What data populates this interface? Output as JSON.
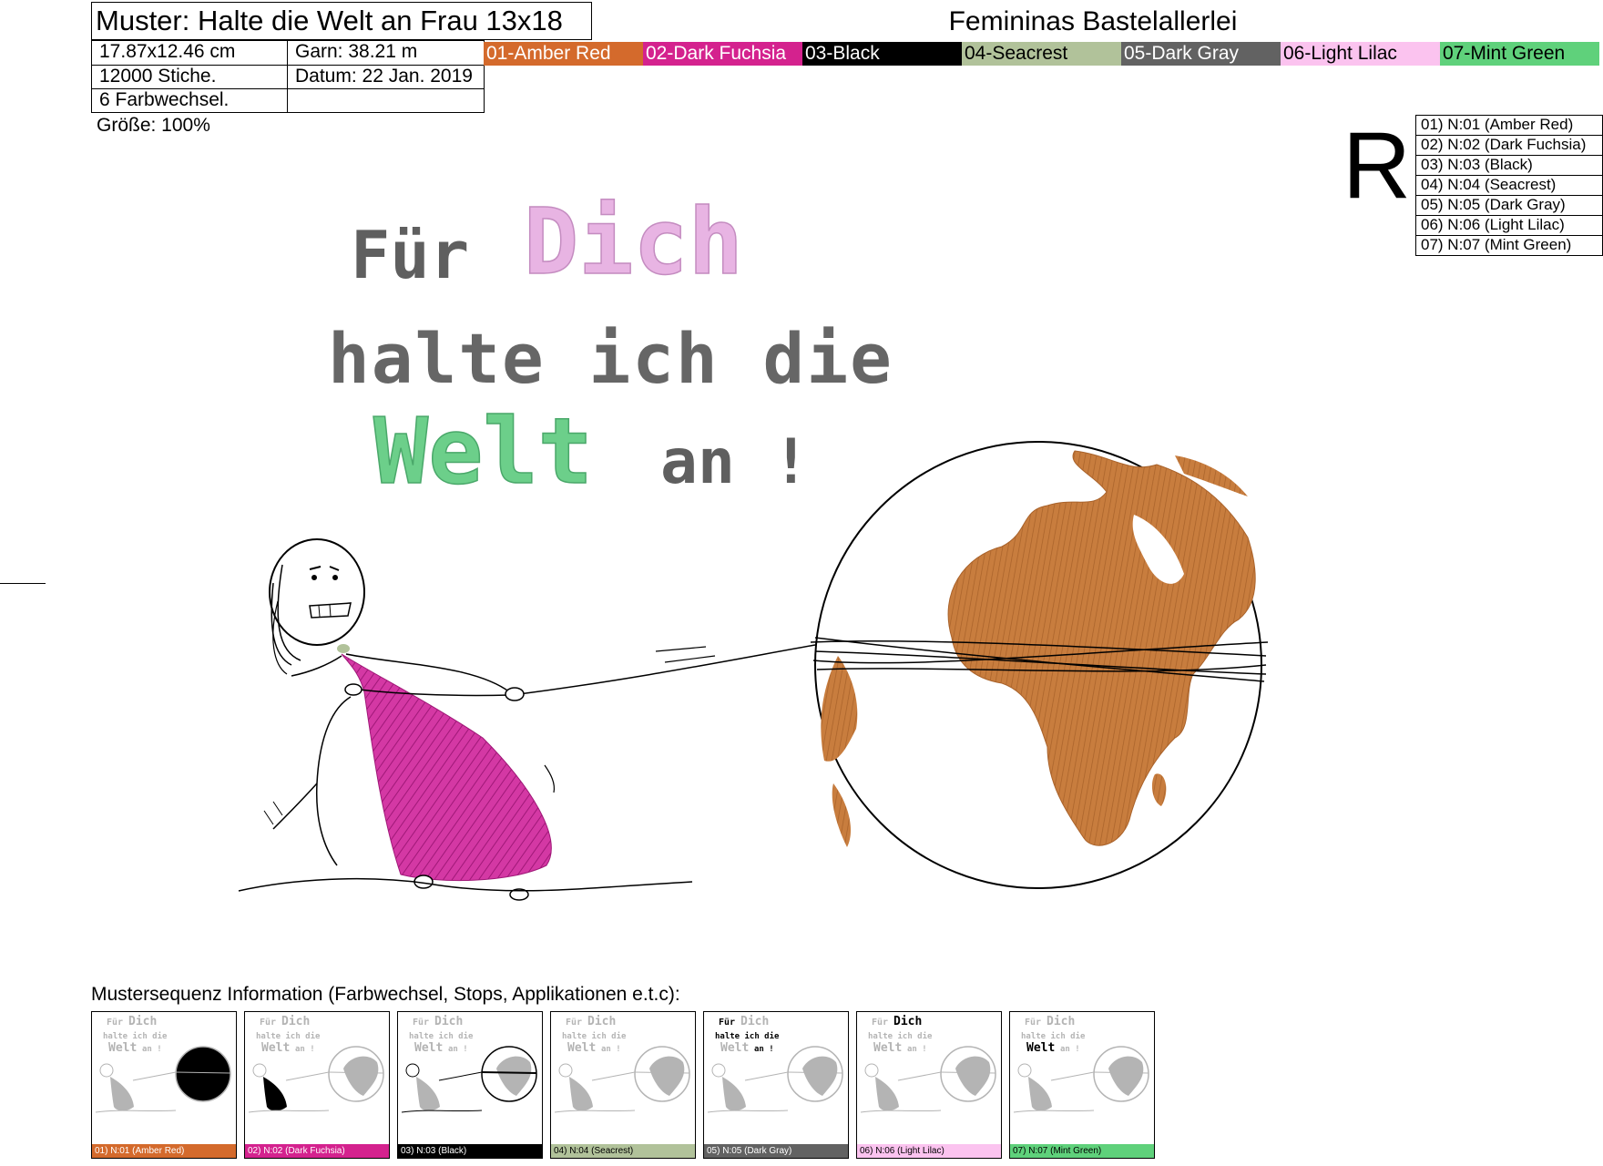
{
  "header": {
    "title": "Muster: Halte die Welt an Frau 13x18",
    "brand": "Femininas Bastelallerlei",
    "size": "17.87x12.46 cm",
    "yarn": "Garn: 38.21 m",
    "stitches": "12000 Stiche.",
    "date": "Datum: 22 Jan. 2019",
    "color_changes": "6 Farbwechsel.",
    "scale": "Größe: 100%"
  },
  "colors": [
    {
      "label": "01-Amber Red",
      "hex": "#d46a2c",
      "text": "#ffffff"
    },
    {
      "label": "02-Dark Fuchsia",
      "hex": "#d4228e",
      "text": "#ffffff"
    },
    {
      "label": "03-Black",
      "hex": "#000000",
      "text": "#ffffff"
    },
    {
      "label": "04-Seacrest",
      "hex": "#b1c29a",
      "text": "#000000"
    },
    {
      "label": "05-Dark Gray",
      "hex": "#626262",
      "text": "#ffffff"
    },
    {
      "label": "06-Light Lilac",
      "hex": "#fbc3ef",
      "text": "#000000"
    },
    {
      "label": "07-Mint Green",
      "hex": "#5fd17b",
      "text": "#000000"
    }
  ],
  "rotation_mark": "R",
  "legend": [
    "01) N:01 (Amber Red)",
    "02) N:02 (Dark Fuchsia)",
    "03) N:03 (Black)",
    "04) N:04 (Seacrest)",
    "05) N:05 (Dark Gray)",
    "06) N:06 (Light Lilac)",
    "07) N:07 (Mint Green)"
  ],
  "design_text": {
    "line1_a": "Für",
    "line1_b": "Dich",
    "line2": "halte ich die",
    "line3_a": "Welt",
    "line3_b": "an !"
  },
  "sequence": {
    "title": "Mustersequenz Information (Farbwechsel, Stops, Applikationen e.t.c):",
    "thumbnails": [
      {
        "label": "01) N:01 (Amber Red)"
      },
      {
        "label": "02) N:02 (Dark Fuchsia)"
      },
      {
        "label": "03) N:03 (Black)"
      },
      {
        "label": "04) N:04 (Seacrest)"
      },
      {
        "label": "05) N:05 (Dark Gray)"
      },
      {
        "label": "06) N:06 (Light Lilac)"
      },
      {
        "label": "07) N:07 (Mint Green)"
      }
    ]
  }
}
